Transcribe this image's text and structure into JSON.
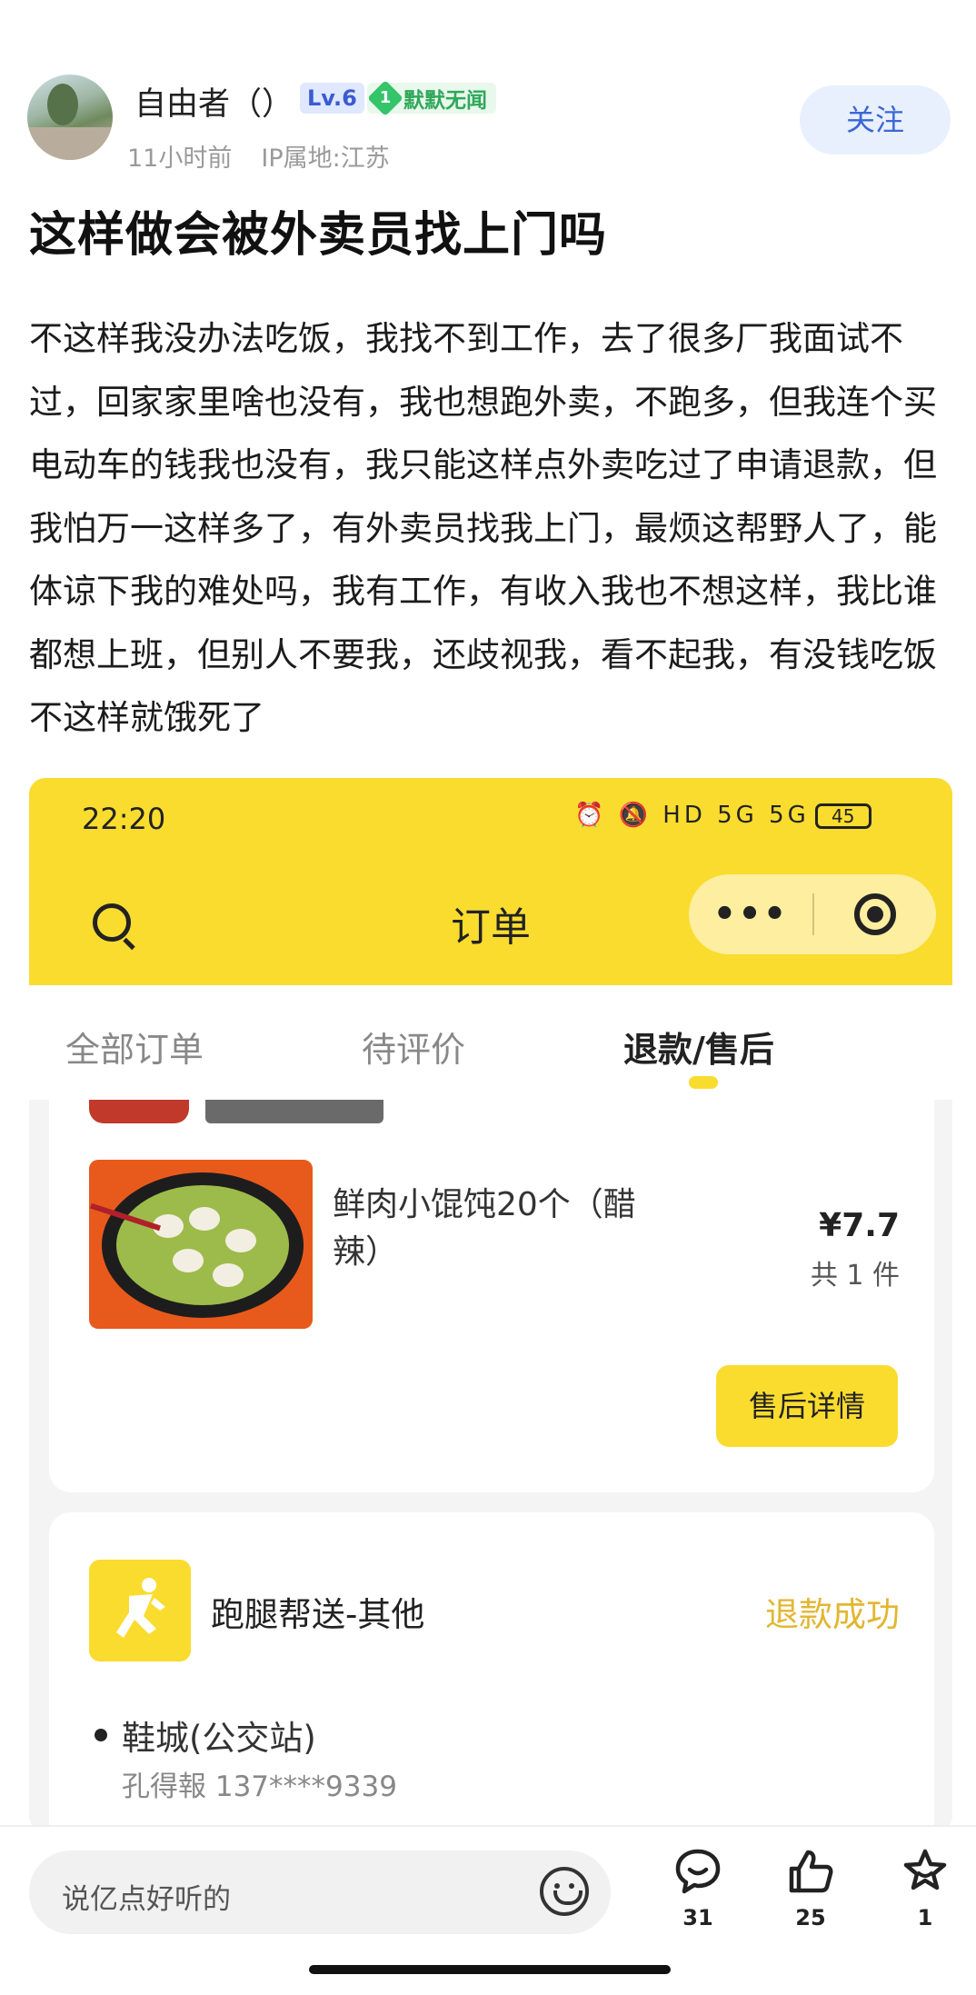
{
  "post": {
    "author": "自由者（）",
    "level": "Lv.6",
    "medal_number": "1",
    "medal_label": "默默无闻",
    "time_ago": "11小时前",
    "ip_location": "IP属地:江苏",
    "follow_label": "关注",
    "title": "这样做会被外卖员找上门吗",
    "body": "不这样我没办法吃饭，我找不到工作，去了很多厂我面试不过，回家家里啥也没有，我也想跑外卖，不跑多，但我连个买电动车的钱我也没有，我只能这样点外卖吃过了申请退款，但我怕万一这样多了，有外卖员找我上门，最烦这帮野人了，能体谅下我的难处吗，我有工作，有收入我也不想这样，我比谁都想上班，但别人不要我，还歧视我，看不起我，有没钱吃饭不这样就饿死了"
  },
  "screenshot": {
    "time": "22:20",
    "status_icons": "⏰ 🔕 HD 5G 5G",
    "battery": "45",
    "nav_title": "订单",
    "tabs": [
      "全部订单",
      "待评价",
      "退款/售后"
    ],
    "order1": {
      "item_name": "鲜肉小馄饨20个（醋辣）",
      "price": "¥7.7",
      "quantity": "共 1 件",
      "after_sale_button": "售后详情"
    },
    "order2": {
      "store_name": "跑腿帮送-其他",
      "status": "退款成功",
      "address": "鞋城(公交站)",
      "contact": "孔得報 137****9339"
    }
  },
  "bottom_bar": {
    "comment_placeholder": "说亿点好听的",
    "comments_count": "31",
    "likes_count": "25",
    "favorites_count": "1"
  },
  "colors": {
    "brand_yellow": "#fadc2f",
    "follow_blue": "#3a66d6",
    "refund_gold": "#e2b631"
  }
}
